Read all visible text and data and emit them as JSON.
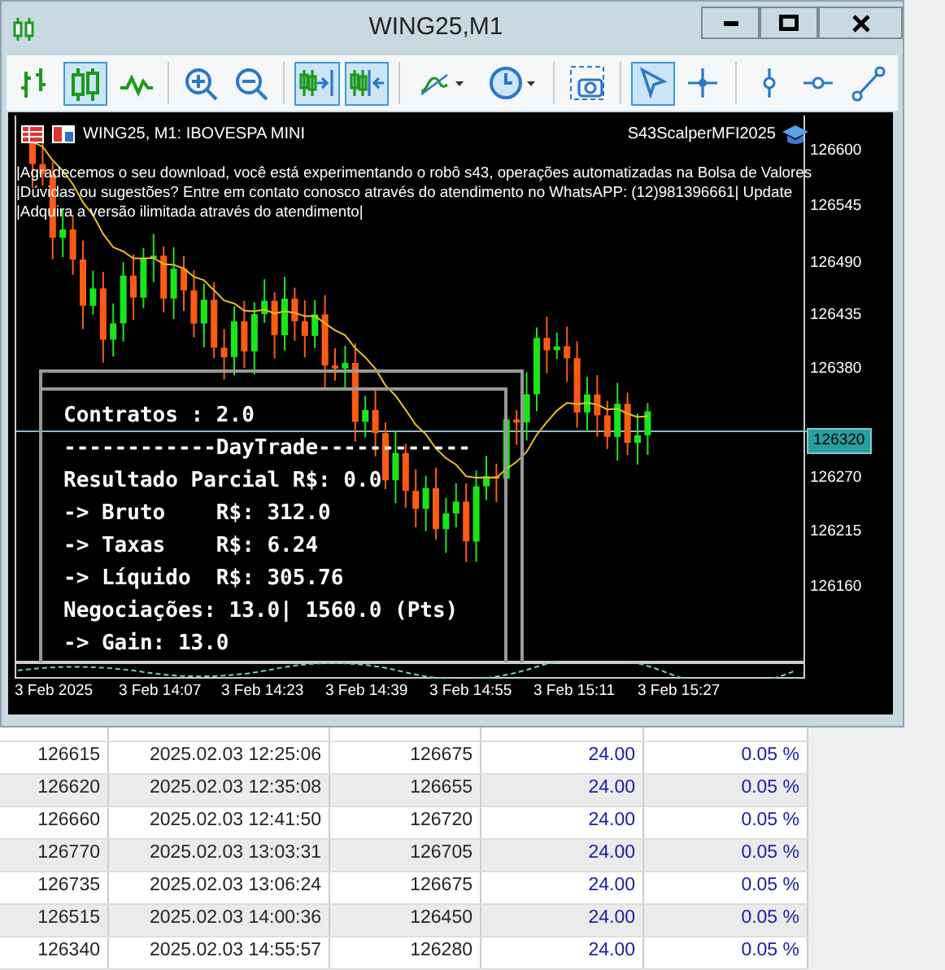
{
  "window": {
    "title": "WING25,M1"
  },
  "toolbar": [
    {
      "kind": "bars",
      "selected": false
    },
    {
      "kind": "candles",
      "selected": true
    },
    {
      "kind": "line",
      "selected": false
    },
    {
      "kind": "sep"
    },
    {
      "kind": "zoom-in",
      "selected": false
    },
    {
      "kind": "zoom-out",
      "selected": false
    },
    {
      "kind": "sep"
    },
    {
      "kind": "autoscroll",
      "selected": true
    },
    {
      "kind": "shift",
      "selected": true
    },
    {
      "kind": "sep"
    },
    {
      "kind": "indicators",
      "selected": false
    },
    {
      "kind": "periods",
      "selected": false
    },
    {
      "kind": "sep"
    },
    {
      "kind": "screenshot",
      "selected": false
    },
    {
      "kind": "sep"
    },
    {
      "kind": "cursor",
      "selected": true
    },
    {
      "kind": "crosshair",
      "selected": false
    },
    {
      "kind": "sep"
    },
    {
      "kind": "vline",
      "selected": false
    },
    {
      "kind": "hline",
      "selected": false
    },
    {
      "kind": "trendline",
      "selected": false
    }
  ],
  "chart": {
    "symbol": "WING25, M1:  IBOVESPA MINI",
    "expert": "S43ScalperMFI2025",
    "messages": [
      "|Agradecemos o seu download, você está experimentando o robô s43, operações automatizadas na Bolsa de Valores",
      "|Dúvidas ou sugestões? Entre em contato conosco através do atendimento no WhatsAPP:  (12)981396661|  Update",
      "|Adquira a versão ilimitada através do atendimento|"
    ],
    "price_labels": [
      "126600",
      "126545",
      "126490",
      "126435",
      "126380",
      "126270",
      "126215",
      "126160"
    ],
    "current_price": "126320",
    "time_labels": [
      "3 Feb 2025",
      "3 Feb 14:07",
      "3 Feb 14:23",
      "3 Feb 14:39",
      "3 Feb 14:55",
      "3 Feb 15:11",
      "3 Feb 15:27"
    ],
    "info_panel": [
      "Contratos : 2.0",
      "------------DayTrade------------",
      "Resultado Parcial R$: 0.0",
      "-> Bruto    R$: 312.0",
      "-> Taxas    R$: 6.24",
      "-> Líquido  R$: 305.76",
      "Negociações: 13.0| 1560.0 (Pts)",
      "-> Gain: 13.0"
    ]
  },
  "table": {
    "rows": [
      [
        "126615",
        "2025.02.03 12:25:06",
        "126675",
        "24.00",
        "0.05 %"
      ],
      [
        "126620",
        "2025.02.03 12:35:08",
        "126655",
        "24.00",
        "0.05 %"
      ],
      [
        "126660",
        "2025.02.03 12:41:50",
        "126720",
        "24.00",
        "0.05 %"
      ],
      [
        "126770",
        "2025.02.03 13:03:31",
        "126705",
        "24.00",
        "0.05 %"
      ],
      [
        "126735",
        "2025.02.03 13:06:24",
        "126675",
        "24.00",
        "0.05 %"
      ],
      [
        "126515",
        "2025.02.03 14:00:36",
        "126450",
        "24.00",
        "0.05 %"
      ],
      [
        "126340",
        "2025.02.03 14:55:57",
        "126280",
        "24.00",
        "0.05 %"
      ]
    ]
  }
}
